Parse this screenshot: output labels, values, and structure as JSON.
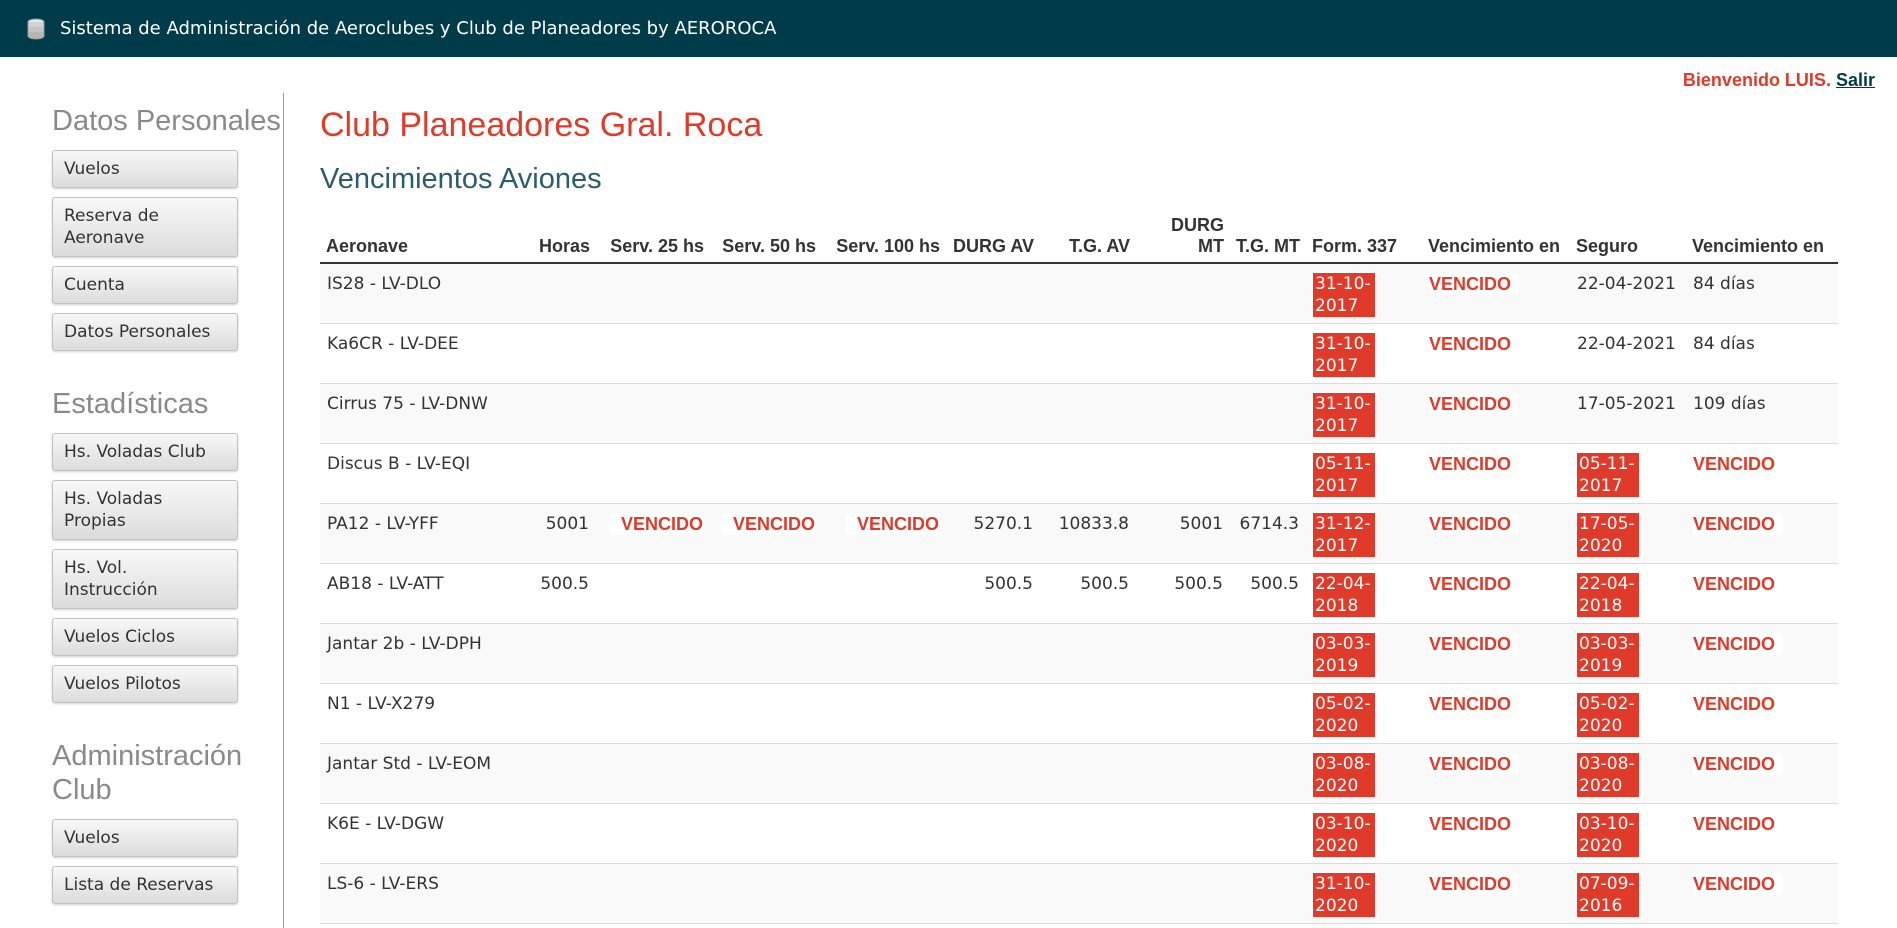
{
  "header": {
    "app_title": "Sistema de Administración de Aeroclubes y Club de Planeadores by AEROROCA",
    "logo_icon": "database-icon"
  },
  "user": {
    "greeting": "Bienvenido LUIS.",
    "logout": "Salir"
  },
  "sidebar": {
    "sections": [
      {
        "title": "Datos Personales",
        "items": [
          "Vuelos",
          "Reserva de Aeronave",
          "Cuenta",
          "Datos Personales"
        ]
      },
      {
        "title": "Estadísticas",
        "items": [
          "Hs. Voladas Club",
          "Hs. Voladas Propias",
          "Hs. Vol. Instrucción",
          "Vuelos Ciclos",
          "Vuelos Pilotos"
        ]
      },
      {
        "title": "Administración Club",
        "items": [
          "Vuelos",
          "Lista de Reservas"
        ]
      }
    ]
  },
  "main": {
    "club_title": "Club Planeadores Gral. Roca",
    "page_title": "Vencimientos Aviones",
    "columns": [
      "Aeronave",
      "Horas",
      "Serv. 25 hs",
      "Serv. 50 hs",
      "Serv. 100 hs",
      "DURG AV",
      "T.G. AV",
      "DURG MT",
      "T.G. MT",
      "Form. 337",
      "Vencimiento en",
      "Seguro",
      "Vencimiento en"
    ],
    "rows": [
      {
        "aeronave": "IS28 - LV-DLO",
        "horas": "",
        "serv25": "",
        "serv50": "",
        "serv100": "",
        "durg_av": "",
        "tg_av": "",
        "durg_mt": "",
        "tg_mt": "",
        "form337": "31-10-2017",
        "form_venc": "VENCIDO",
        "seguro": "22-04-2021",
        "seguro_venc": "84 días"
      },
      {
        "aeronave": "Ka6CR - LV-DEE",
        "horas": "",
        "serv25": "",
        "serv50": "",
        "serv100": "",
        "durg_av": "",
        "tg_av": "",
        "durg_mt": "",
        "tg_mt": "",
        "form337": "31-10-2017",
        "form_venc": "VENCIDO",
        "seguro": "22-04-2021",
        "seguro_venc": "84 días"
      },
      {
        "aeronave": "Cirrus 75 - LV-DNW",
        "horas": "",
        "serv25": "",
        "serv50": "",
        "serv100": "",
        "durg_av": "",
        "tg_av": "",
        "durg_mt": "",
        "tg_mt": "",
        "form337": "31-10-2017",
        "form_venc": "VENCIDO",
        "seguro": "17-05-2021",
        "seguro_venc": "109 días"
      },
      {
        "aeronave": "Discus B - LV-EQI",
        "horas": "",
        "serv25": "",
        "serv50": "",
        "serv100": "",
        "durg_av": "",
        "tg_av": "",
        "durg_mt": "",
        "tg_mt": "",
        "form337": "05-11-2017",
        "form_venc": "VENCIDO",
        "seguro": "05-11-2017",
        "seguro_venc": "VENCIDO"
      },
      {
        "aeronave": "PA12 - LV-YFF",
        "horas": "5001",
        "serv25": "VENCIDO",
        "serv50": "VENCIDO",
        "serv100": "VENCIDO",
        "durg_av": "5270.1",
        "tg_av": "10833.8",
        "durg_mt": "5001",
        "tg_mt": "6714.3",
        "form337": "31-12-2017",
        "form_venc": "VENCIDO",
        "seguro": "17-05-2020",
        "seguro_venc": "VENCIDO"
      },
      {
        "aeronave": "AB18 - LV-ATT",
        "horas": "500.5",
        "serv25": "",
        "serv50": "",
        "serv100": "",
        "durg_av": "500.5",
        "tg_av": "500.5",
        "durg_mt": "500.5",
        "tg_mt": "500.5",
        "form337": "22-04-2018",
        "form_venc": "VENCIDO",
        "seguro": "22-04-2018",
        "seguro_venc": "VENCIDO"
      },
      {
        "aeronave": "Jantar 2b - LV-DPH",
        "horas": "",
        "serv25": "",
        "serv50": "",
        "serv100": "",
        "durg_av": "",
        "tg_av": "",
        "durg_mt": "",
        "tg_mt": "",
        "form337": "03-03-2019",
        "form_venc": "VENCIDO",
        "seguro": "03-03-2019",
        "seguro_venc": "VENCIDO"
      },
      {
        "aeronave": "N1 - LV-X279",
        "horas": "",
        "serv25": "",
        "serv50": "",
        "serv100": "",
        "durg_av": "",
        "tg_av": "",
        "durg_mt": "",
        "tg_mt": "",
        "form337": "05-02-2020",
        "form_venc": "VENCIDO",
        "seguro": "05-02-2020",
        "seguro_venc": "VENCIDO"
      },
      {
        "aeronave": "Jantar Std - LV-EOM",
        "horas": "",
        "serv25": "",
        "serv50": "",
        "serv100": "",
        "durg_av": "",
        "tg_av": "",
        "durg_mt": "",
        "tg_mt": "",
        "form337": "03-08-2020",
        "form_venc": "VENCIDO",
        "seguro": "03-08-2020",
        "seguro_venc": "VENCIDO"
      },
      {
        "aeronave": "K6E - LV-DGW",
        "horas": "",
        "serv25": "",
        "serv50": "",
        "serv100": "",
        "durg_av": "",
        "tg_av": "",
        "durg_mt": "",
        "tg_mt": "",
        "form337": "03-10-2020",
        "form_venc": "VENCIDO",
        "seguro": "03-10-2020",
        "seguro_venc": "VENCIDO"
      },
      {
        "aeronave": "LS-6 - LV-ERS",
        "horas": "",
        "serv25": "",
        "serv50": "",
        "serv100": "",
        "durg_av": "",
        "tg_av": "",
        "durg_mt": "",
        "tg_mt": "",
        "form337": "31-10-2020",
        "form_venc": "VENCIDO",
        "seguro": "07-09-2016",
        "seguro_venc": "VENCIDO"
      }
    ]
  },
  "colors": {
    "topbar": "#003b4a",
    "accent_red": "#e03a2a",
    "subtitle_teal": "#2a5d6e",
    "sidebar_heading": "#8a8a8a"
  }
}
